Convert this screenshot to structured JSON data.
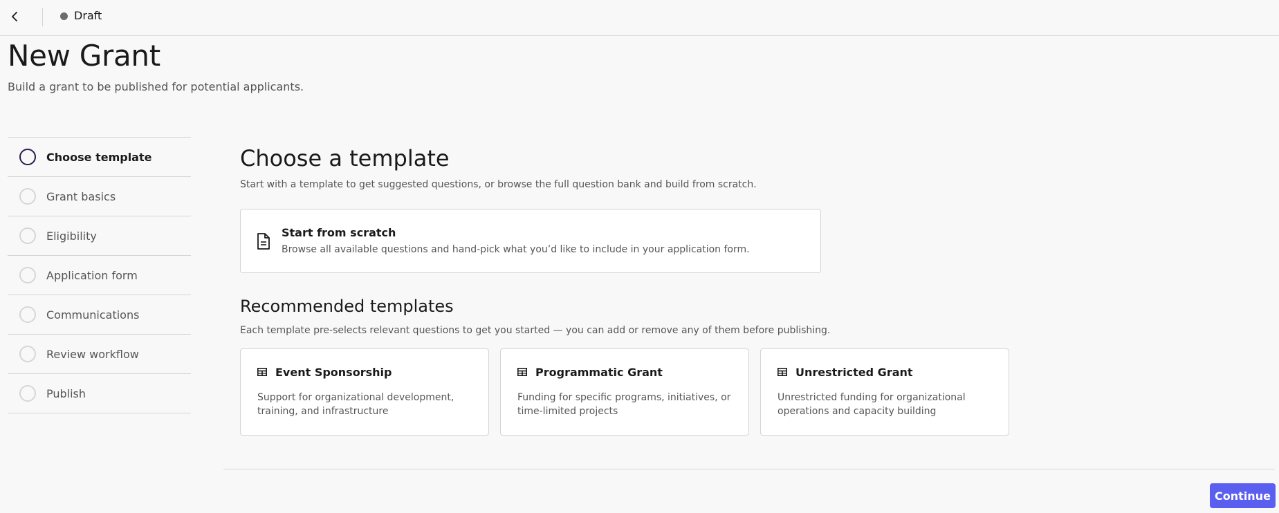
{
  "header": {
    "status": "Draft"
  },
  "page": {
    "title": "New Grant",
    "subtitle": "Build a grant to be published for potential applicants."
  },
  "steps": [
    {
      "label": "Choose template",
      "active": true
    },
    {
      "label": "Grant basics",
      "active": false
    },
    {
      "label": "Eligibility",
      "active": false
    },
    {
      "label": "Application form",
      "active": false
    },
    {
      "label": "Communications",
      "active": false
    },
    {
      "label": "Review workflow",
      "active": false
    },
    {
      "label": "Publish",
      "active": false
    }
  ],
  "main": {
    "title": "Choose a template",
    "description": "Start with a template to get suggested questions, or browse the full question bank and build from scratch.",
    "scratch": {
      "title": "Start from scratch",
      "description": "Browse all available questions and hand-pick what you’d like to include in your application form."
    },
    "recommended": {
      "title": "Recommended templates",
      "description": "Each template pre-selects relevant questions to get you started — you can add or remove any of them before publishing.",
      "templates": [
        {
          "title": "Event Sponsorship",
          "description": "Support for organizational development, training, and infrastructure"
        },
        {
          "title": "Programmatic Grant",
          "description": "Funding for specific programs, initiatives, or time-limited projects"
        },
        {
          "title": "Unrestricted Grant",
          "description": "Unrestricted funding for organizational operations and capacity building"
        }
      ]
    }
  },
  "footer": {
    "continue_label": "Continue"
  },
  "colors": {
    "accent": "#5b5ff0",
    "active_step": "#2b1a4d",
    "status_dot": "#6b6b6b"
  }
}
